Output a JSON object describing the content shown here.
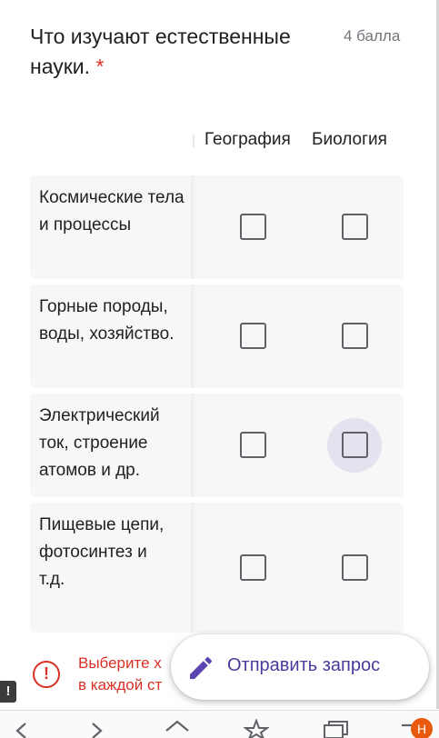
{
  "question": {
    "title": "Что изучают естественные науки.",
    "required_mark": "*",
    "points": "4 балла"
  },
  "columns": [
    "География",
    "Биология"
  ],
  "rows": [
    {
      "label": "Космические тела и процессы",
      "geography_checked": false,
      "biology_checked": false
    },
    {
      "label": "Горные породы, воды, хозяйство.",
      "geography_checked": false,
      "biology_checked": false
    },
    {
      "label": "Электрический ток, строение атомов и др.",
      "geography_checked": false,
      "biology_checked": false,
      "biology_hovered": true
    },
    {
      "label": "Пищевые цепи, фотосинтез и т.д.",
      "geography_checked": false,
      "biology_checked": false
    }
  ],
  "error": {
    "line1": "Выберите х",
    "line2": "в каждой ст",
    "icon": "exclamation-circle-icon"
  },
  "submit": {
    "label": "Отправить запрос",
    "icon": "pencil-icon"
  },
  "side_tab": {
    "label": "!"
  },
  "nav": {
    "badge": "Н",
    "icons": [
      "back-icon",
      "forward-icon",
      "home-icon",
      "star-icon",
      "tabs-icon",
      "menu-icon"
    ]
  },
  "colors": {
    "accent": "#4b3a9a",
    "error": "#d93025",
    "checkbox_border": "#5f6368",
    "row_bg": "#f7f7f7",
    "hover_ripple": "#e5e1ef",
    "badge": "#e8590c"
  }
}
